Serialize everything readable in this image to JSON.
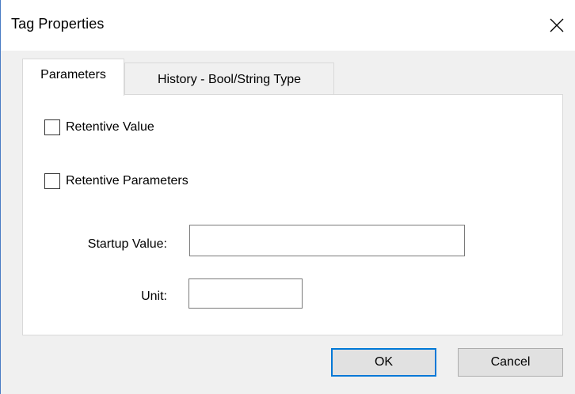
{
  "window": {
    "title": "Tag Properties"
  },
  "tabs": [
    {
      "label": "Parameters",
      "active": true
    },
    {
      "label": "History - Bool/String Type",
      "active": false
    }
  ],
  "parameters": {
    "retentive_value": {
      "label": "Retentive Value",
      "checked": false
    },
    "retentive_parameters": {
      "label": "Retentive Parameters",
      "checked": false
    },
    "startup_value": {
      "label": "Startup Value:",
      "value": ""
    },
    "unit": {
      "label": "Unit:",
      "value": ""
    }
  },
  "buttons": {
    "ok": "OK",
    "cancel": "Cancel"
  },
  "icons": {
    "close": "close-icon"
  },
  "colors": {
    "window_background": "#f0f0f0",
    "panel_background": "#ffffff",
    "default_button_border": "#0078d7",
    "window_border": "#4a7cc4"
  }
}
